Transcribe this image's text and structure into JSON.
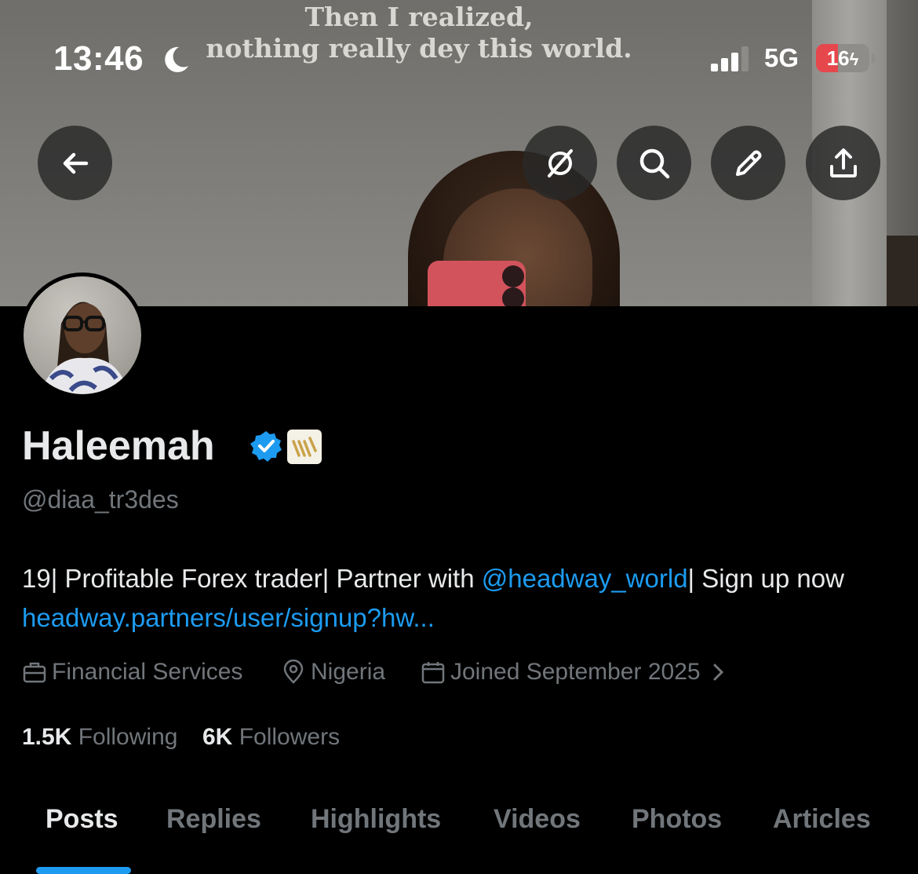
{
  "status_bar": {
    "time": "13:46",
    "network": "5G",
    "battery": "16",
    "battery_percent": 16,
    "focus_icon": "moon-icon"
  },
  "banner": {
    "quote_line1": "Then I realized,",
    "quote_line2": "nothing really dey this world."
  },
  "header_buttons": {
    "back": "arrow-left-icon",
    "grok": "grok-icon",
    "search": "search-icon",
    "edit": "pencil-icon",
    "share": "share-icon"
  },
  "profile": {
    "name": "Haleemah",
    "handle": "@diaa_tr3des",
    "bio_part1": "19| Profitable Forex trader| Partner with ",
    "bio_mention": "@headway_world",
    "bio_part2": "| Sign up now ",
    "bio_link": "headway.partners/user/signup?hw...",
    "category": "Financial Services",
    "location": "Nigeria",
    "joined": "Joined September 2025",
    "following_count": "1.5K",
    "following_label": "Following",
    "followers_count": "6K",
    "followers_label": "Followers"
  },
  "tabs": [
    {
      "label": "Posts",
      "active": true
    },
    {
      "label": "Replies"
    },
    {
      "label": "Highlights"
    },
    {
      "label": "Videos"
    },
    {
      "label": "Photos"
    },
    {
      "label": "Articles"
    }
  ],
  "colors": {
    "background": "#000000",
    "text": "#e7e9ea",
    "secondary_text": "#71767b",
    "link": "#1d9bf0",
    "battery_low": "#e6474c"
  }
}
